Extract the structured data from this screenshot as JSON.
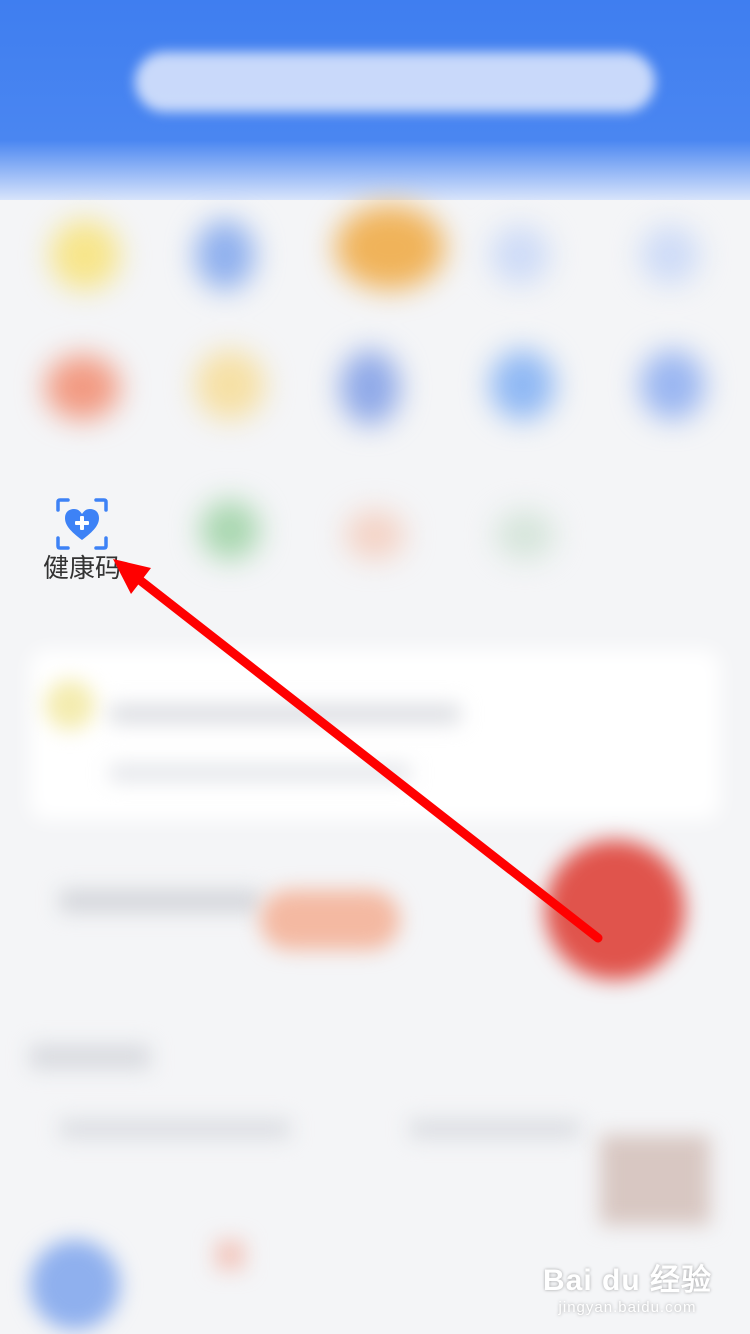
{
  "app": {
    "health_code": {
      "label": "健康码",
      "icon": "heart-plus-scan-icon"
    }
  },
  "watermark": {
    "brand": "Bai du 经验",
    "url": "jingyan.baidu.com"
  },
  "colors": {
    "header_blue": "#3f7ef0",
    "icon_blue": "#3d82f6",
    "arrow_red": "#ff0000"
  }
}
